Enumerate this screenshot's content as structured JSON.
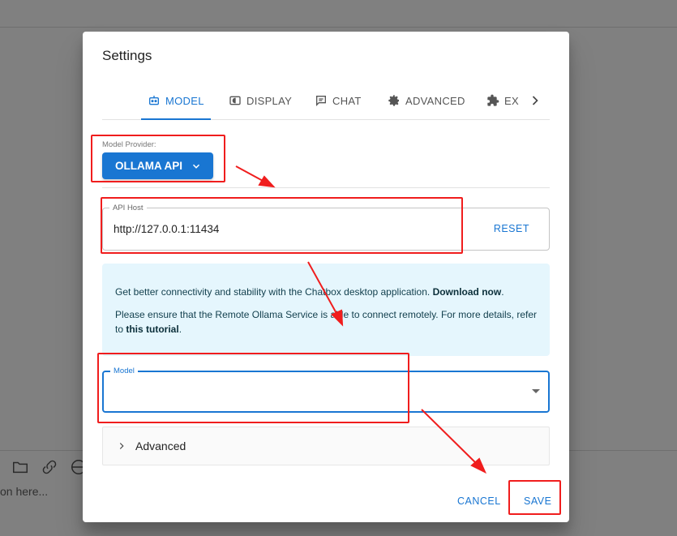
{
  "background": {
    "input_placeholder": "on here..."
  },
  "dialog": {
    "title": "Settings",
    "tabs": [
      {
        "label": "MODEL",
        "icon": "robot-icon",
        "active": true
      },
      {
        "label": "DISPLAY",
        "icon": "display-icon",
        "active": false
      },
      {
        "label": "CHAT",
        "icon": "chat-icon",
        "active": false
      },
      {
        "label": "ADVANCED",
        "icon": "gear-icon",
        "active": false
      },
      {
        "label": "EX",
        "icon": "puzzle-icon",
        "active": false
      }
    ],
    "provider": {
      "label": "Model Provider:",
      "value": "OLLAMA API"
    },
    "api_host": {
      "label": "API Host",
      "value": "http://127.0.0.1:11434",
      "reset_label": "RESET"
    },
    "info": {
      "line1_text": "Get better connectivity and stability with the Chatbox desktop application. ",
      "line1_link": "Download now",
      "line1_end": ".",
      "line2_text": "Please ensure that the Remote Ollama Service is able to connect remotely. For more details, refer to ",
      "line2_link": "this tutorial",
      "line2_end": "."
    },
    "model": {
      "label": "Model",
      "value": ""
    },
    "advanced_label": "Advanced",
    "cancel_label": "CANCEL",
    "save_label": "SAVE"
  },
  "colors": {
    "accent": "#1976d2",
    "annotation": "#f01d1d",
    "info_bg": "#e5f6fd",
    "overlay": "#808080"
  }
}
